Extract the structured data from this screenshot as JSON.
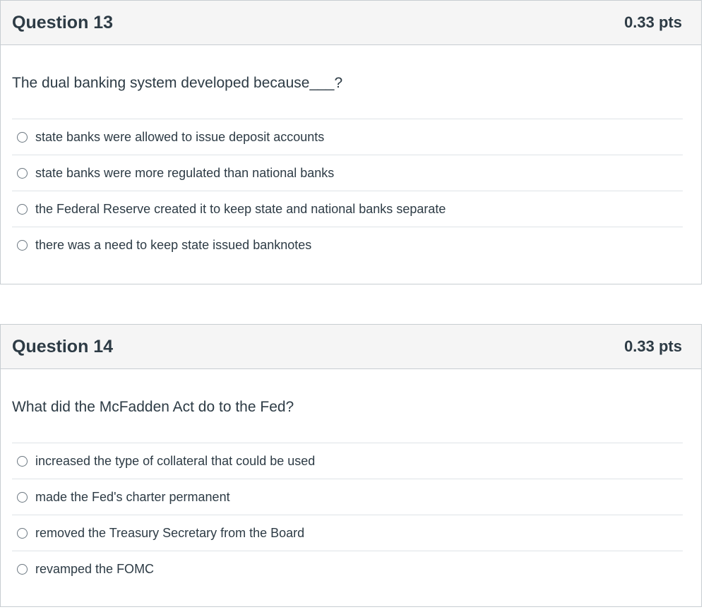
{
  "questions": [
    {
      "title": "Question 13",
      "points": "0.33 pts",
      "prompt": "The dual banking system developed because___?",
      "answers": [
        "state banks were allowed to issue deposit accounts",
        "state banks were more regulated than national banks",
        "the Federal Reserve created it to keep state and national banks separate",
        "there was a need to keep state issued banknotes"
      ]
    },
    {
      "title": "Question 14",
      "points": "0.33 pts",
      "prompt": "What did the McFadden Act do to the Fed?",
      "answers": [
        "increased the type of collateral that could be used",
        "made the Fed's charter permanent",
        "removed the Treasury Secretary from the Board",
        "revamped the FOMC"
      ]
    }
  ],
  "colors": {
    "text": "#2d3b45",
    "header_bg": "#f5f5f5",
    "border": "#c7cdd1",
    "divider": "#dfe3e6"
  }
}
